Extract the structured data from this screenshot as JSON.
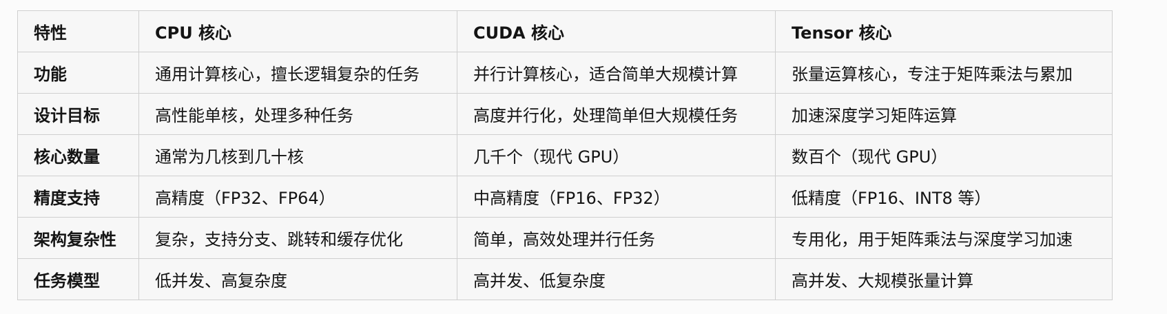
{
  "table": {
    "headers": [
      "特性",
      "CPU 核心",
      "CUDA 核心",
      "Tensor 核心"
    ],
    "rows": [
      [
        "功能",
        "通用计算核心，擅长逻辑复杂的任务",
        "并行计算核心，适合简单大规模计算",
        "张量运算核心，专注于矩阵乘法与累加"
      ],
      [
        "设计目标",
        "高性能单核，处理多种任务",
        "高度并行化，处理简单但大规模任务",
        "加速深度学习矩阵运算"
      ],
      [
        "核心数量",
        "通常为几核到几十核",
        "几千个（现代 GPU）",
        "数百个（现代 GPU）"
      ],
      [
        "精度支持",
        "高精度（FP32、FP64）",
        "中高精度（FP16、FP32）",
        "低精度（FP16、INT8 等）"
      ],
      [
        "架构复杂性",
        "复杂，支持分支、跳转和缓存优化",
        "简单，高效处理并行任务",
        "专用化，用于矩阵乘法与深度学习加速"
      ],
      [
        "任务模型",
        "低并发、高复杂度",
        "高并发、低复杂度",
        "高并发、大规模张量计算"
      ]
    ]
  }
}
